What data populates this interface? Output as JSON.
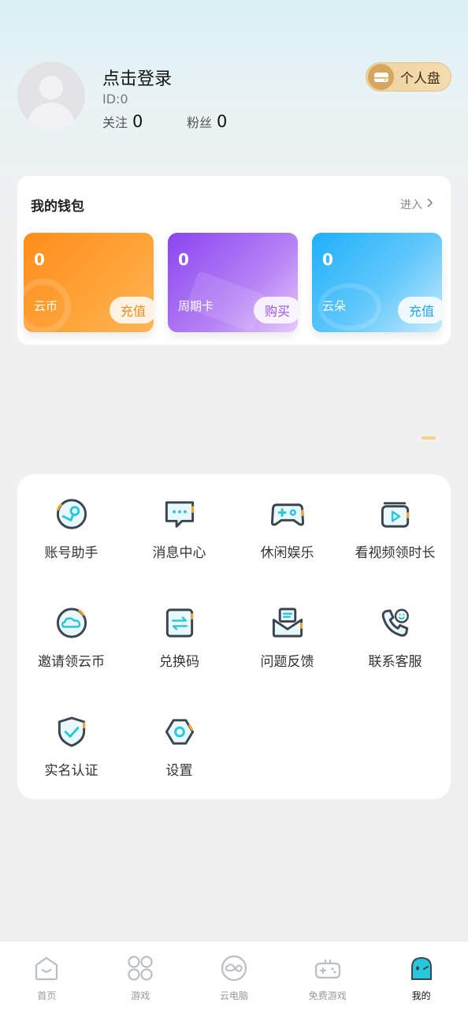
{
  "profile": {
    "login_text": "点击登录",
    "id_text": "ID:0",
    "follow_label": "关注",
    "follow_count": "0",
    "fans_label": "粉丝",
    "fans_count": "0",
    "disk_button": "个人盘"
  },
  "wallet": {
    "title": "我的钱包",
    "enter_label": "进入",
    "cards": [
      {
        "amount": "0",
        "name": "云币",
        "action": "充值"
      },
      {
        "amount": "0",
        "name": "周期卡",
        "action": "购买"
      },
      {
        "amount": "0",
        "name": "云朵",
        "action": "充值"
      }
    ]
  },
  "tools": [
    {
      "label": "账号助手",
      "icon": "steam-icon"
    },
    {
      "label": "消息中心",
      "icon": "message-icon"
    },
    {
      "label": "休闲娱乐",
      "icon": "gamepad-icon"
    },
    {
      "label": "看视频领时长",
      "icon": "video-icon"
    },
    {
      "label": "邀请领云币",
      "icon": "cloud-invite-icon"
    },
    {
      "label": "兑换码",
      "icon": "exchange-icon"
    },
    {
      "label": "问题反馈",
      "icon": "feedback-icon"
    },
    {
      "label": "联系客服",
      "icon": "phone-icon"
    },
    {
      "label": "实名认证",
      "icon": "shield-check-icon"
    },
    {
      "label": "设置",
      "icon": "settings-icon"
    }
  ],
  "nav": [
    {
      "label": "首页",
      "icon": "home-icon"
    },
    {
      "label": "游戏",
      "icon": "apps-icon"
    },
    {
      "label": "云电脑",
      "icon": "cloud-pc-icon"
    },
    {
      "label": "免费游戏",
      "icon": "gamepad-icon"
    },
    {
      "label": "我的",
      "icon": "ghost-icon",
      "active": true
    }
  ],
  "colors": {
    "accent_cyan": "#28c8dc",
    "icon_dark": "#3a4550",
    "icon_fill": "#e8f8fb",
    "icon_orange": "#f4a53a"
  }
}
